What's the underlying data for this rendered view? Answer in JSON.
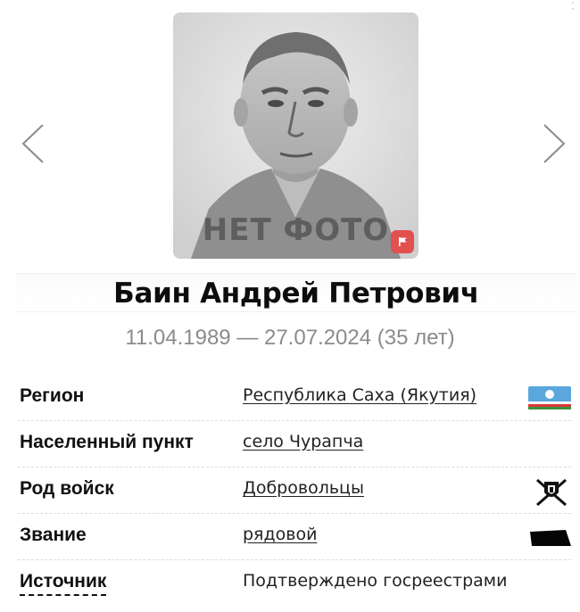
{
  "photo": {
    "placeholder_text": "НЕТ ФОТО",
    "flag_icon": "flag-icon",
    "flag_color": "#e25050"
  },
  "navigation": {
    "prev_icon": "chevron-left-icon",
    "next_icon": "chevron-right-icon"
  },
  "person": {
    "name": "Баин Андрей Петрович",
    "dates": "11.04.1989 — 27.07.2024 (35 лет)"
  },
  "details": [
    {
      "label": "Регион",
      "value": "Республика Саха (Якутия)",
      "link": true,
      "icon": "yakutia-flag-icon"
    },
    {
      "label": "Населенный пункт",
      "value": "село Чурапча",
      "link": true,
      "icon": ""
    },
    {
      "label": "Род войск",
      "value": "Добровольцы",
      "link": true,
      "icon": "volunteers-emblem-icon"
    },
    {
      "label": "Звание",
      "value": "рядовой",
      "link": true,
      "icon": "private-rank-insignia-icon"
    },
    {
      "label": "Источник",
      "value": "Подтверждено госреестрами",
      "link": false,
      "icon": ""
    }
  ],
  "colors": {
    "text": "#111111",
    "muted": "#8b8b8b",
    "flag_blue": "#5aa7dd",
    "flag_white": "#ffffff",
    "flag_green": "#3f8f3f",
    "flag_red": "#d83a3a"
  }
}
